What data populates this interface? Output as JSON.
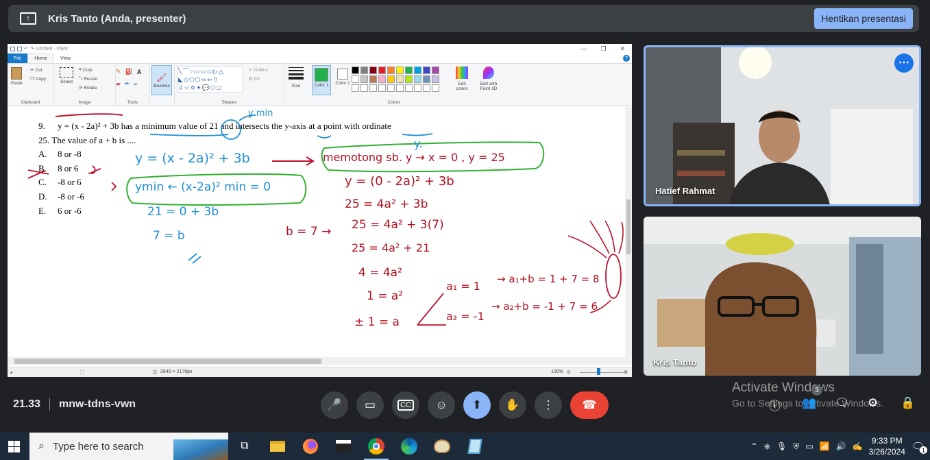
{
  "presenter_bar": {
    "title": "Kris Tanto (Anda, presenter)",
    "stop_button": "Hentikan presentasi"
  },
  "paint": {
    "window_title": "Untitled - Paint",
    "tabs": [
      "File",
      "Home",
      "View"
    ],
    "groups": {
      "clipboard": "Clipboard",
      "image": "Image",
      "tools": "Tools",
      "shapes": "Shapes",
      "colors": "Colors"
    },
    "buttons": {
      "paste": "Paste",
      "cut": "Cut",
      "copy": "Copy",
      "select": "Select",
      "crop": "Crop",
      "resize": "Resize",
      "rotate": "Rotate",
      "brushes": "Brushes",
      "outline": "Outline",
      "fill": "Fill",
      "size": "Size",
      "color1": "Color 1",
      "color2": "Color 2",
      "edit_colors": "Edit colors",
      "edit_paint3d": "Edit with Paint 3D"
    },
    "palette": [
      "#000000",
      "#7f7f7f",
      "#880015",
      "#ed1c24",
      "#ff7f27",
      "#fff200",
      "#22b14c",
      "#00a2e8",
      "#3f48cc",
      "#a349a4",
      "#ffffff",
      "#c3c3c3",
      "#b97a57",
      "#ffaec9",
      "#ffc90e",
      "#efe4b0",
      "#b5e61d",
      "#99d9ea",
      "#7092be",
      "#c8bfe7",
      "#ffffff",
      "#ffffff",
      "#ffffff",
      "#ffffff",
      "#ffffff",
      "#ffffff",
      "#ffffff",
      "#ffffff",
      "#ffffff",
      "#ffffff"
    ],
    "color1": "#22b14c",
    "status": {
      "dimensions": "2640 × 2176px",
      "zoom": "100%"
    },
    "question": {
      "line1_num": "9.",
      "line1": "y = (x - 2a)² + 3b has a minimum value of 21 and intersects the y-axis at a point with ordinate",
      "line2": "25. The value of a + b is ....",
      "options": [
        {
          "label": "A.",
          "text": "8 or -8"
        },
        {
          "label": "B.",
          "text": "8 or 6"
        },
        {
          "label": "C.",
          "text": "-8 or 6"
        },
        {
          "label": "D.",
          "text": "-8 or -6"
        },
        {
          "label": "E.",
          "text": "6 or -6"
        }
      ]
    },
    "handwriting": {
      "ymin_note": "y min",
      "y_note": "y.",
      "b1": "y = (x - 2a)² + 3b",
      "b2": "ymin ← (x-2a)² min = 0",
      "b3": "21 = 0 + 3b",
      "b4": "7 = b",
      "b5": "//",
      "g1": "memotong sb. y → x = 0 , y = 25",
      "r1": "y = (0 - 2a)² + 3b",
      "r2": "25 = 4a² + 3b",
      "r3": "b = 7 →",
      "r4": "25 = 4a² + 3(7)",
      "r5": "25 = 4a² + 21",
      "r6": "4 = 4a²",
      "r7": "1 = a²",
      "r8": "± 1 = a",
      "r9": "a₁ = 1",
      "r10": "→ a₁+b = 1 + 7 = 8",
      "r11": "a₂ = -1",
      "r12": "→ a₂+b = -1 + 7 = 6"
    }
  },
  "participants": [
    {
      "name": "Hatief Rahmat"
    },
    {
      "name": "Kris Tanto"
    }
  ],
  "watermark": {
    "line1": "Activate Windows",
    "line2": "Go to Settings to activate Windows."
  },
  "meeting": {
    "time": "21.33",
    "code": "mnw-tdns-vwn",
    "people_count": "3"
  },
  "taskbar": {
    "search_placeholder": "Type here to search",
    "time": "9:33 PM",
    "date": "3/26/2024",
    "notif_count": "1"
  }
}
